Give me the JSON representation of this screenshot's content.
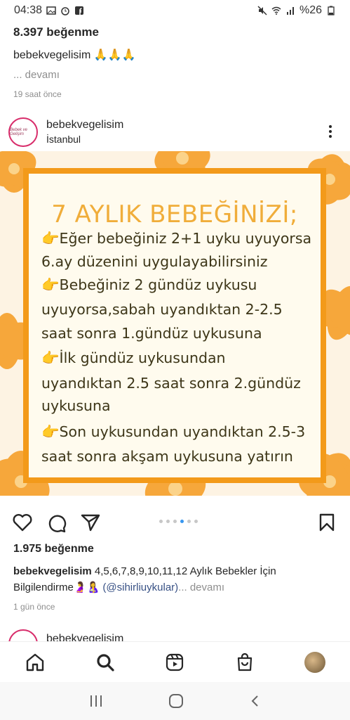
{
  "status_bar": {
    "time": "04:38",
    "battery": "%26",
    "left_icons": [
      "image-icon",
      "alarm-icon",
      "facebook-icon"
    ],
    "right_icons": [
      "mute-icon",
      "wifi-icon",
      "signal-icon",
      "battery-icon"
    ]
  },
  "previous_post": {
    "likes": "8.397 beğenme",
    "caption": "bebekvegelisim 🙏🙏🙏",
    "more": "... devamı",
    "time": "19 saat önce"
  },
  "post": {
    "username": "bebekvegelisim",
    "location": "İstanbul",
    "avatar_text": "Bebek ve Gelişim",
    "image": {
      "title": "7 AYLIK BEBEĞİNİZİ;",
      "lines": [
        "Eğer bebeğiniz 2+1 uyku uyuyorsa",
        "6.ay düzenini uygulayabilirsiniz",
        "Bebeğiniz 2 gündüz uykusu",
        "uyuyorsa,sabah uyandıktan 2-2.5",
        "saat sonra 1.gündüz uykusuna",
        "İlk gündüz uykusundan",
        "uyandıktan 2.5 saat sonra 2.gündüz",
        "uykusuna",
        "Son uykusundan uyandıktan 2.5-3",
        "saat sonra akşam uykusuna yatırın"
      ],
      "pointer_glyph": "👉"
    },
    "likes": "1.975 beğenme",
    "caption_user": "bebekvegelisim",
    "caption_text": "4,5,6,7,8,9,10,11,12 Aylık Bebekler İçin Bilgilendirme",
    "caption_emoji": "🤰🤱",
    "mention": "(@sihirliuykular)",
    "more": "... devamı",
    "time": "1 gün önce",
    "carousel": {
      "count": 6,
      "active_index": 3
    }
  },
  "next_post": {
    "username": "bebekvegelisim"
  },
  "colors": {
    "accent_blue": "#3897f0",
    "flower_orange": "#f6a73b",
    "frame_orange": "#f39a1a",
    "title_orange": "#f0ad3a"
  }
}
